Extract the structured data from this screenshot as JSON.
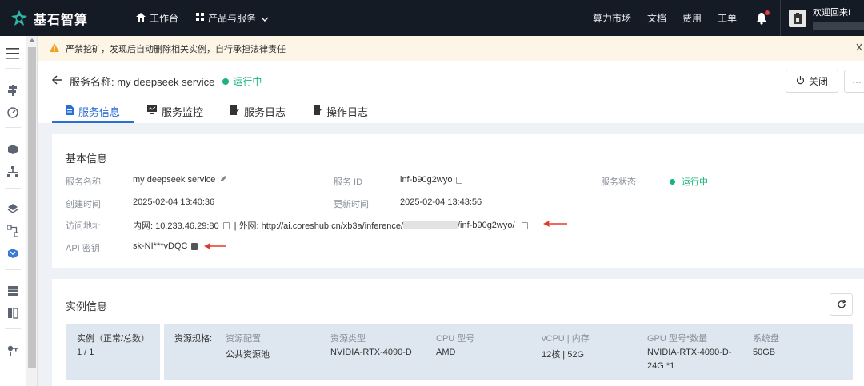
{
  "topbar": {
    "logo_text": "基石智算",
    "nav": [
      {
        "label": "工作台",
        "icon": "home-icon"
      },
      {
        "label": "产品与服务",
        "icon": "grid-icon"
      }
    ],
    "links": [
      "算力市场",
      "文档",
      "费用",
      "工单"
    ],
    "welcome": "欢迎回来!"
  },
  "warning": {
    "text": "严禁挖矿，发现后自动删除相关实例，自行承担法律责任"
  },
  "header": {
    "title": "服务名称: my deepseek service",
    "status": "运行中",
    "close_label": "关闭",
    "more_label": "···",
    "tabs": [
      {
        "label": "服务信息",
        "icon": "document-icon",
        "active": true
      },
      {
        "label": "服务监控",
        "icon": "monitor-icon",
        "active": false
      },
      {
        "label": "服务日志",
        "icon": "log-icon",
        "active": false
      },
      {
        "label": "操作日志",
        "icon": "operation-log-icon",
        "active": false
      }
    ]
  },
  "basic": {
    "title": "基本信息",
    "service_name_label": "服务名称",
    "service_name": "my deepseek service",
    "service_id_label": "服务 ID",
    "service_id": "inf-b90g2wyo",
    "service_status_label": "服务状态",
    "service_status": "运行中",
    "created_label": "创建时间",
    "created": "2025-02-04 13:40:36",
    "updated_label": "更新时间",
    "updated": "2025-02-04 13:43:56",
    "access_label": "访问地址",
    "access_internal": "内网: 10.233.46.29:80",
    "access_sep": "| 外网: http://ai.coreshub.cn/xb3a/inference/",
    "access_tail": "/inf-b90g2wyo/",
    "api_key_label": "API 密钥",
    "api_key": "sk-NI***vDQC"
  },
  "instance": {
    "title": "实例信息",
    "count_label": "实例（正常/总数）",
    "count": "1 / 1",
    "spec_label": "资源规格:",
    "columns": [
      {
        "head": "资源配置",
        "value": "公共资源池"
      },
      {
        "head": "资源类型",
        "value": "NVIDIA-RTX-4090-D"
      },
      {
        "head": "CPU 型号",
        "value": "AMD"
      },
      {
        "head": "vCPU | 内存",
        "value": "12核 | 52G"
      },
      {
        "head": "GPU 型号*数量",
        "value": "NVIDIA-RTX-4090-D-",
        "value2": "24G *1"
      },
      {
        "head": "系统盘",
        "value": "50GB"
      }
    ]
  },
  "colors": {
    "topbar_bg": "#151b25",
    "accent_blue": "#2a6fd6",
    "status_green": "#1ab37a",
    "warning_bg": "#fdf6e6",
    "arrow_red": "#e0392b"
  }
}
